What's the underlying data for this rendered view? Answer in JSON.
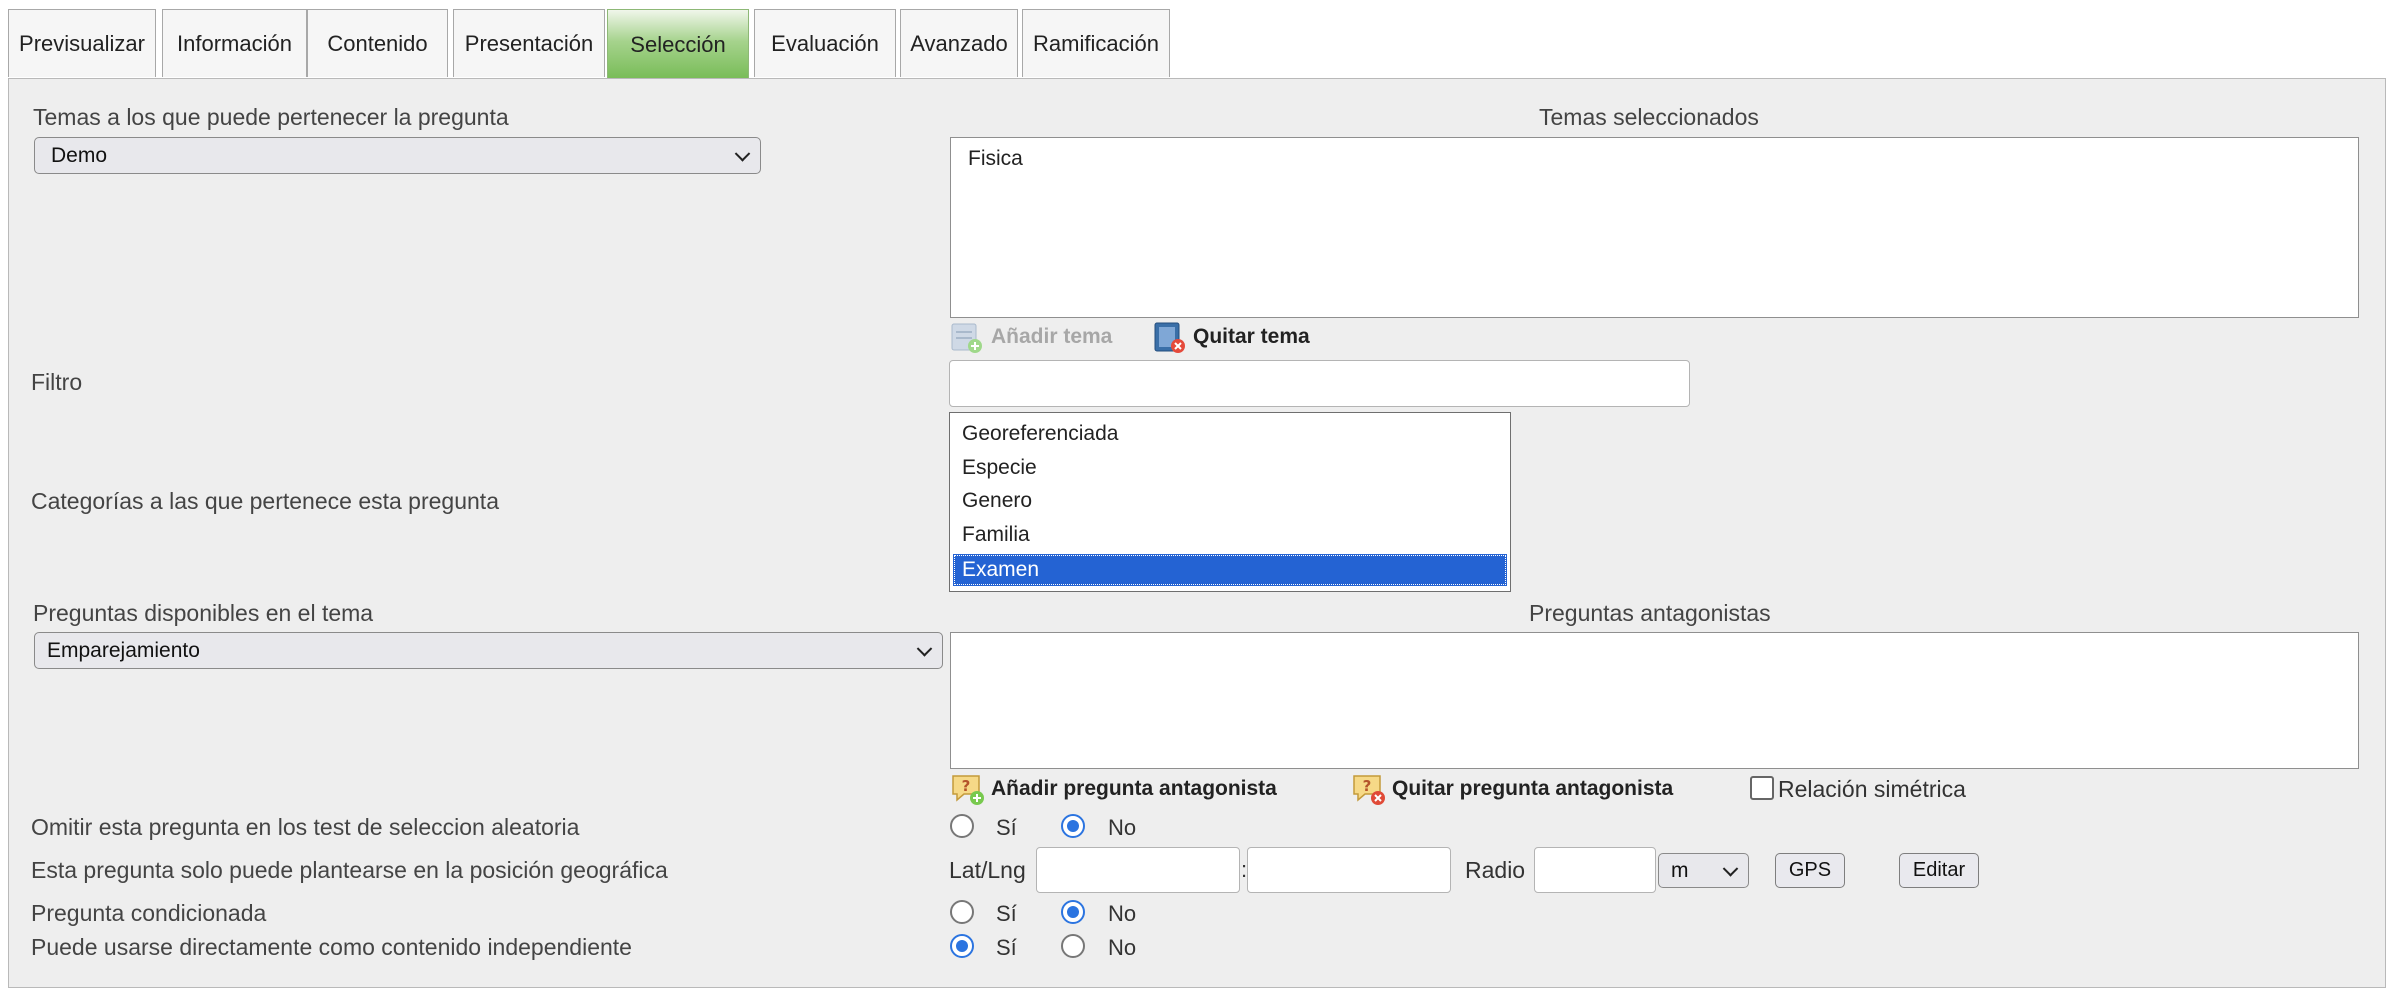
{
  "tabs": [
    {
      "label": "Previsualizar"
    },
    {
      "label": "Información"
    },
    {
      "label": "Contenido"
    },
    {
      "label": "Presentación"
    },
    {
      "label": "Selección"
    },
    {
      "label": "Evaluación"
    },
    {
      "label": "Avanzado"
    },
    {
      "label": "Ramificación"
    }
  ],
  "active_tab": "Selección",
  "temas": {
    "label": "Temas a los que puede pertenecer la pregunta",
    "selected_value": "Demo",
    "selected_title": "Temas seleccionados",
    "selected_items": [
      "Fisica"
    ],
    "add_label": "Añadir tema",
    "remove_label": "Quitar tema"
  },
  "filtro": {
    "label": "Filtro",
    "value": ""
  },
  "categorias": {
    "label": "Categorías a las que pertenece esta pregunta",
    "options": [
      "Georeferenciada",
      "Especie",
      "Genero",
      "Familia",
      "Examen"
    ],
    "selected": "Examen"
  },
  "preguntas": {
    "label": "Preguntas disponibles en el tema",
    "selected_value": "Emparejamiento",
    "antagonistas_title": "Preguntas antagonistas",
    "add_label": "Añadir pregunta antagonista",
    "remove_label": "Quitar pregunta antagonista",
    "symmetric_label": "Relación simétrica",
    "symmetric_checked": false
  },
  "omitir": {
    "label": "Omitir esta pregunta en los test de seleccion aleatoria",
    "yes": "Sí",
    "no": "No",
    "value": "No"
  },
  "geo": {
    "label": "Esta pregunta solo puede plantearse en la posición geográfica",
    "latlng_label": "Lat/Lng",
    "separator": ":",
    "lat": "",
    "lng": "",
    "radio_label": "Radio",
    "radio_value": "",
    "unit": "m",
    "gps_button": "GPS",
    "edit_button": "Editar"
  },
  "condicionada": {
    "label": "Pregunta condicionada",
    "yes": "Sí",
    "no": "No",
    "value": "No"
  },
  "independiente": {
    "label": "Puede usarse directamente como contenido independiente",
    "yes": "Sí",
    "no": "No",
    "value": "Sí"
  }
}
